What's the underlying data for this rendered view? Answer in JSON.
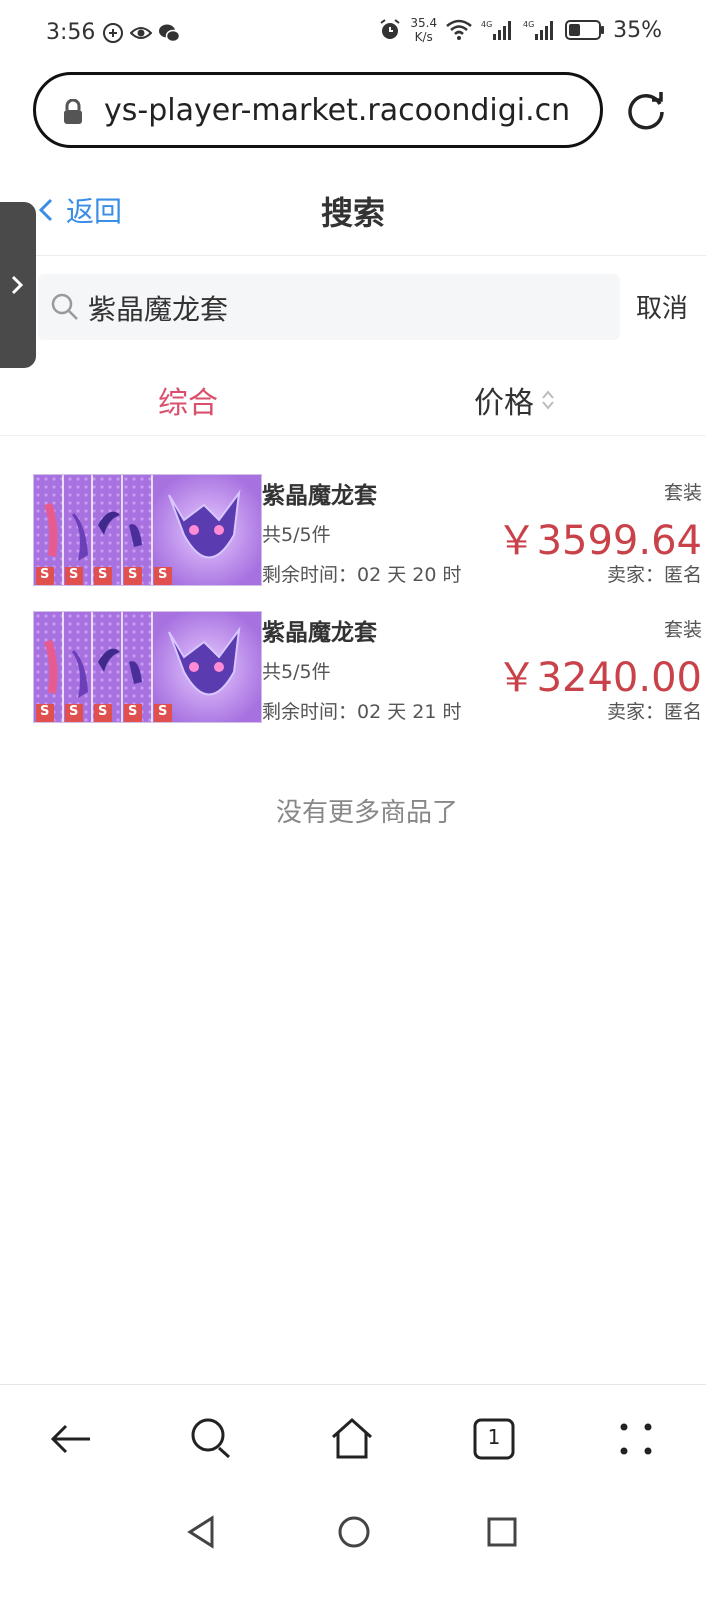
{
  "status": {
    "time": "3:56",
    "net_speed_value": "35.4",
    "net_speed_unit": "K/s",
    "battery": "35%"
  },
  "browser": {
    "url": "ys-player-market.racoondigi.cn",
    "tab_count": "1"
  },
  "header": {
    "back_label": "返回",
    "title": "搜索"
  },
  "search": {
    "value": "紫晶魔龙套",
    "cancel_label": "取消"
  },
  "sort": {
    "overall_label": "综合",
    "price_label": "价格",
    "active_color": "#d9506d"
  },
  "products": [
    {
      "name": "紫晶魔龙套",
      "count": "共5/5件",
      "time_left": "剩余时间：02 天 20 时",
      "type": "套装",
      "price": "￥3599.64",
      "seller": "卖家：匿名",
      "badge": "S"
    },
    {
      "name": "紫晶魔龙套",
      "count": "共5/5件",
      "time_left": "剩余时间：02 天 21 时",
      "type": "套装",
      "price": "￥3240.00",
      "seller": "卖家：匿名",
      "badge": "S"
    }
  ],
  "list_end": "没有更多商品了",
  "colors": {
    "price": "#c9424a",
    "link": "#3a8ee6",
    "thumb_bg": "#a772e0"
  }
}
